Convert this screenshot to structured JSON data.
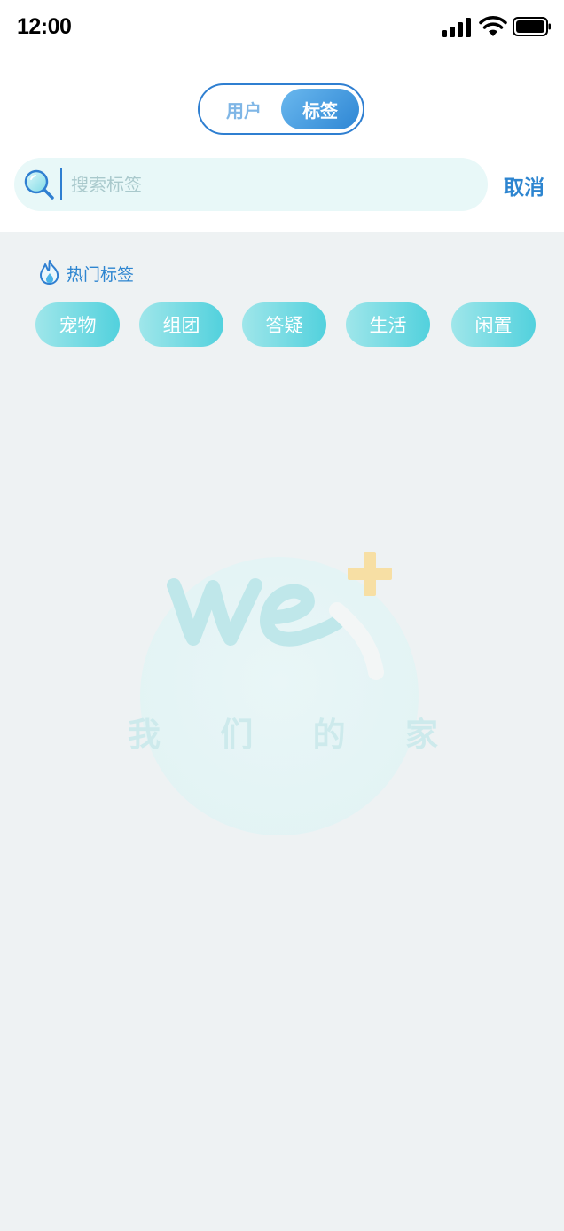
{
  "status_bar": {
    "time": "12:00"
  },
  "segmented": {
    "users_label": "用户",
    "tags_label": "标签",
    "active": "tags"
  },
  "search": {
    "placeholder": "搜索标签",
    "value": "",
    "cancel_label": "取消"
  },
  "hot_tags": {
    "title": "热门标签",
    "items": [
      "宠物",
      "组团",
      "答疑",
      "生活",
      "闲置"
    ]
  },
  "watermark": {
    "chars": [
      "我",
      "们",
      "的",
      "家"
    ]
  },
  "colors": {
    "accent": "#2d85d0",
    "chip_start": "#9fe6ea",
    "chip_end": "#52d1dd",
    "search_bg": "#e8f8f8",
    "page_bg": "#eef2f3"
  },
  "icons": [
    "search-icon",
    "flame-icon",
    "signal-icon",
    "wifi-icon",
    "battery-icon",
    "we-plus-logo"
  ]
}
